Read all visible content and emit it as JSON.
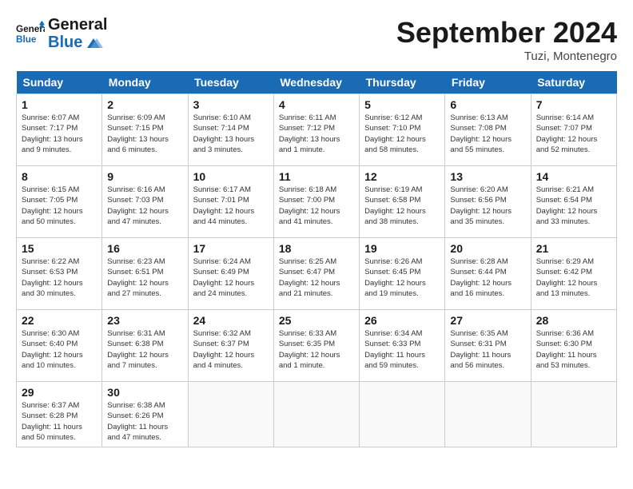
{
  "header": {
    "logo_general": "General",
    "logo_blue": "Blue",
    "month_title": "September 2024",
    "subtitle": "Tuzi, Montenegro"
  },
  "days_of_week": [
    "Sunday",
    "Monday",
    "Tuesday",
    "Wednesday",
    "Thursday",
    "Friday",
    "Saturday"
  ],
  "weeks": [
    [
      {
        "num": "1",
        "sunrise": "6:07 AM",
        "sunset": "7:17 PM",
        "daylight": "13 hours and 9 minutes."
      },
      {
        "num": "2",
        "sunrise": "6:09 AM",
        "sunset": "7:15 PM",
        "daylight": "13 hours and 6 minutes."
      },
      {
        "num": "3",
        "sunrise": "6:10 AM",
        "sunset": "7:14 PM",
        "daylight": "13 hours and 3 minutes."
      },
      {
        "num": "4",
        "sunrise": "6:11 AM",
        "sunset": "7:12 PM",
        "daylight": "13 hours and 1 minute."
      },
      {
        "num": "5",
        "sunrise": "6:12 AM",
        "sunset": "7:10 PM",
        "daylight": "12 hours and 58 minutes."
      },
      {
        "num": "6",
        "sunrise": "6:13 AM",
        "sunset": "7:08 PM",
        "daylight": "12 hours and 55 minutes."
      },
      {
        "num": "7",
        "sunrise": "6:14 AM",
        "sunset": "7:07 PM",
        "daylight": "12 hours and 52 minutes."
      }
    ],
    [
      {
        "num": "8",
        "sunrise": "6:15 AM",
        "sunset": "7:05 PM",
        "daylight": "12 hours and 50 minutes."
      },
      {
        "num": "9",
        "sunrise": "6:16 AM",
        "sunset": "7:03 PM",
        "daylight": "12 hours and 47 minutes."
      },
      {
        "num": "10",
        "sunrise": "6:17 AM",
        "sunset": "7:01 PM",
        "daylight": "12 hours and 44 minutes."
      },
      {
        "num": "11",
        "sunrise": "6:18 AM",
        "sunset": "7:00 PM",
        "daylight": "12 hours and 41 minutes."
      },
      {
        "num": "12",
        "sunrise": "6:19 AM",
        "sunset": "6:58 PM",
        "daylight": "12 hours and 38 minutes."
      },
      {
        "num": "13",
        "sunrise": "6:20 AM",
        "sunset": "6:56 PM",
        "daylight": "12 hours and 35 minutes."
      },
      {
        "num": "14",
        "sunrise": "6:21 AM",
        "sunset": "6:54 PM",
        "daylight": "12 hours and 33 minutes."
      }
    ],
    [
      {
        "num": "15",
        "sunrise": "6:22 AM",
        "sunset": "6:53 PM",
        "daylight": "12 hours and 30 minutes."
      },
      {
        "num": "16",
        "sunrise": "6:23 AM",
        "sunset": "6:51 PM",
        "daylight": "12 hours and 27 minutes."
      },
      {
        "num": "17",
        "sunrise": "6:24 AM",
        "sunset": "6:49 PM",
        "daylight": "12 hours and 24 minutes."
      },
      {
        "num": "18",
        "sunrise": "6:25 AM",
        "sunset": "6:47 PM",
        "daylight": "12 hours and 21 minutes."
      },
      {
        "num": "19",
        "sunrise": "6:26 AM",
        "sunset": "6:45 PM",
        "daylight": "12 hours and 19 minutes."
      },
      {
        "num": "20",
        "sunrise": "6:28 AM",
        "sunset": "6:44 PM",
        "daylight": "12 hours and 16 minutes."
      },
      {
        "num": "21",
        "sunrise": "6:29 AM",
        "sunset": "6:42 PM",
        "daylight": "12 hours and 13 minutes."
      }
    ],
    [
      {
        "num": "22",
        "sunrise": "6:30 AM",
        "sunset": "6:40 PM",
        "daylight": "12 hours and 10 minutes."
      },
      {
        "num": "23",
        "sunrise": "6:31 AM",
        "sunset": "6:38 PM",
        "daylight": "12 hours and 7 minutes."
      },
      {
        "num": "24",
        "sunrise": "6:32 AM",
        "sunset": "6:37 PM",
        "daylight": "12 hours and 4 minutes."
      },
      {
        "num": "25",
        "sunrise": "6:33 AM",
        "sunset": "6:35 PM",
        "daylight": "12 hours and 1 minute."
      },
      {
        "num": "26",
        "sunrise": "6:34 AM",
        "sunset": "6:33 PM",
        "daylight": "11 hours and 59 minutes."
      },
      {
        "num": "27",
        "sunrise": "6:35 AM",
        "sunset": "6:31 PM",
        "daylight": "11 hours and 56 minutes."
      },
      {
        "num": "28",
        "sunrise": "6:36 AM",
        "sunset": "6:30 PM",
        "daylight": "11 hours and 53 minutes."
      }
    ],
    [
      {
        "num": "29",
        "sunrise": "6:37 AM",
        "sunset": "6:28 PM",
        "daylight": "11 hours and 50 minutes."
      },
      {
        "num": "30",
        "sunrise": "6:38 AM",
        "sunset": "6:26 PM",
        "daylight": "11 hours and 47 minutes."
      },
      null,
      null,
      null,
      null,
      null
    ]
  ],
  "labels": {
    "sunrise": "Sunrise:",
    "sunset": "Sunset:",
    "daylight": "Daylight:"
  }
}
